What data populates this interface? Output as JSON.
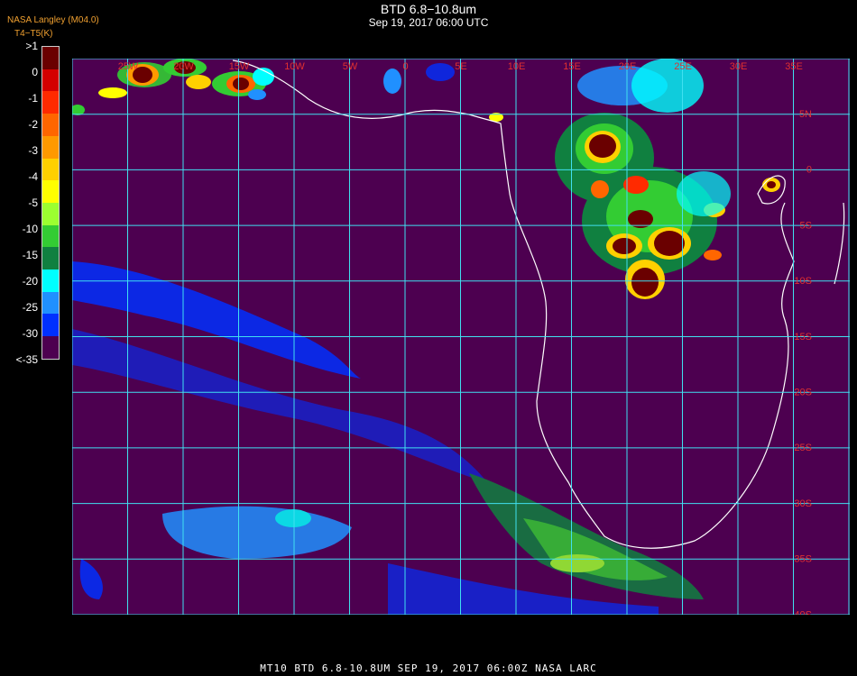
{
  "header": {
    "title": "BTD 6.8−10.8um",
    "subtitle": "Sep 19, 2017 06:00 UTC",
    "source": "NASA Langley (M04.0)",
    "units_label": "T4−T5(K)"
  },
  "colorbar": {
    "labels": [
      ">1",
      "0",
      "-1",
      "-2",
      "-3",
      "-4",
      "-5",
      "-10",
      "-15",
      "-20",
      "-25",
      "-30",
      "<-35"
    ],
    "colors": [
      "#6a0000",
      "#d40000",
      "#ff2a00",
      "#ff6600",
      "#ff9900",
      "#ffd000",
      "#ffff00",
      "#9cff30",
      "#33cc33",
      "#108040",
      "#00ffff",
      "#2090ff",
      "#0030ff",
      "#4d0050"
    ]
  },
  "map": {
    "background_color": "#4d0050",
    "grid_color": "#40e0f0",
    "coast_color": "#ffffff",
    "lon_labels": [
      "25W",
      "20W",
      "15W",
      "10W",
      "5W",
      "0",
      "5E",
      "10E",
      "15E",
      "20E",
      "25E",
      "30E",
      "35E"
    ],
    "lat_labels": [
      "5N",
      "0",
      "5S",
      "10S",
      "15S",
      "20S",
      "25S",
      "30S",
      "35S",
      "40S"
    ]
  },
  "footer": {
    "text": "MT10   BTD 6.8-10.8UM    SEP 19, 2017 06:00Z   NASA LARC"
  }
}
